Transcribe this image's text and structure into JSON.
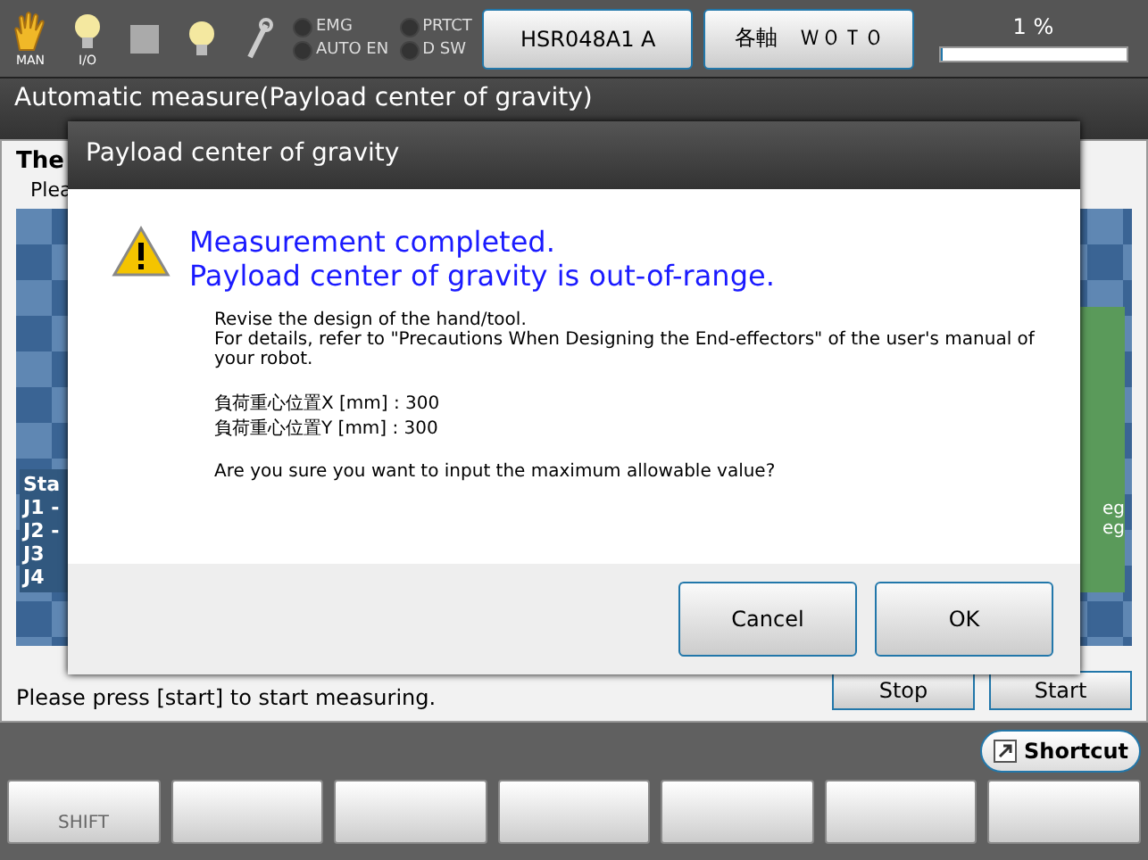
{
  "status_bar": {
    "mode_icons": [
      {
        "kind": "hand",
        "label": "MAN"
      },
      {
        "kind": "bulb",
        "label": "I/O"
      },
      {
        "kind": "square"
      },
      {
        "kind": "bulb"
      },
      {
        "kind": "wrench"
      }
    ],
    "lamps": [
      {
        "label": "EMG",
        "on": false
      },
      {
        "label": "PRTCT",
        "on": false
      },
      {
        "label": "AUTO EN",
        "on": false
      },
      {
        "label": "D SW",
        "on": false
      }
    ],
    "buttons": [
      "HSR048A1 A",
      "各軸　Ｗ０Ｔ０"
    ],
    "progress": {
      "reading": "1 %",
      "level": 0.01
    }
  },
  "screen": {
    "title": "Automatic measure(Payload center of gravity)",
    "heading": "The",
    "hint": "Plea",
    "panel_lines": [
      "Sta",
      "J1 -",
      "J2 -",
      "J3",
      "J4"
    ],
    "side_lines": [
      "eg",
      "eg"
    ],
    "message": "Please press [start] to start measuring.",
    "buttons": [
      "Stop",
      "Start"
    ]
  },
  "dialog": {
    "title": "Payload center of gravity",
    "headline": [
      "Measurement completed.",
      "Payload center of gravity is out-of-range."
    ],
    "body": [
      "Revise the design of the hand/tool.",
      "For details, refer to \"Precautions When Designing the End-effectors\" of the user's manual of your robot."
    ],
    "values": [
      "負荷重心位置X [mm] : 300",
      "負荷重心位置Y [mm] : 300"
    ],
    "question": "Are you sure you want to input the maximum allowable value?",
    "buttons": [
      "Cancel",
      "OK"
    ]
  },
  "shortcut": {
    "label": "Shortcut"
  },
  "function_keys": [
    {
      "kind": "labeled",
      "label": "SHIFT"
    },
    {
      "kind": "blank"
    },
    {
      "kind": "blank"
    },
    {
      "kind": "blank"
    },
    {
      "kind": "blank"
    },
    {
      "kind": "blank"
    },
    {
      "kind": "blank"
    }
  ]
}
